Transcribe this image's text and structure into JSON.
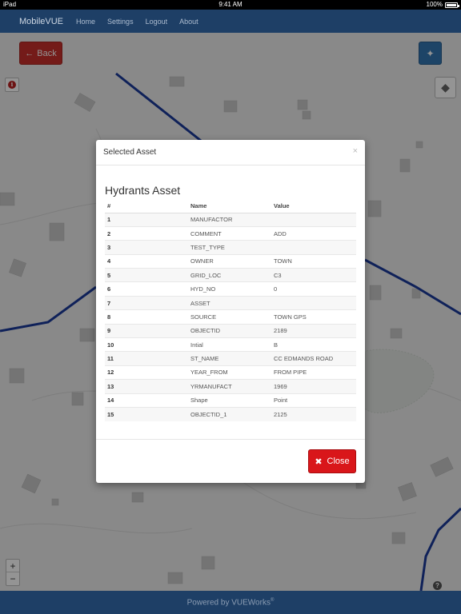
{
  "statusbar": {
    "device": "iPad",
    "time": "9:41 AM",
    "battery": "100%"
  },
  "navbar": {
    "brand": "MobileVUE",
    "links": [
      "Home",
      "Settings",
      "Logout",
      "About"
    ]
  },
  "toolbar": {
    "back_label": "Back"
  },
  "map": {
    "accent_road": "#1a3a9a"
  },
  "modal": {
    "title": "Selected Asset",
    "close_x": "×",
    "asset_title": "Hydrants Asset",
    "columns": [
      "#",
      "Name",
      "Value"
    ],
    "rows": [
      [
        "1",
        "MANUFACTOR",
        ""
      ],
      [
        "2",
        "COMMENT",
        "ADD"
      ],
      [
        "3",
        "TEST_TYPE",
        ""
      ],
      [
        "4",
        "OWNER",
        "TOWN"
      ],
      [
        "5",
        "GRID_LOC",
        "C3"
      ],
      [
        "6",
        "HYD_NO",
        "0"
      ],
      [
        "7",
        "ASSET",
        ""
      ],
      [
        "8",
        "SOURCE",
        "TOWN GPS"
      ],
      [
        "9",
        "OBJECTID",
        "2189"
      ],
      [
        "10",
        "Intial",
        "B"
      ],
      [
        "11",
        "ST_NAME",
        "CC EDMANDS ROAD"
      ],
      [
        "12",
        "YEAR_FROM",
        "FROM PIPE"
      ],
      [
        "13",
        "YRMANUFACT",
        "1969"
      ],
      [
        "14",
        "Shape",
        "Point"
      ],
      [
        "15",
        "OBJECTID_1",
        "2125"
      ]
    ],
    "close_label": "Close"
  },
  "footer": {
    "text": "Powered by VUEWorks",
    "mark": "®"
  }
}
